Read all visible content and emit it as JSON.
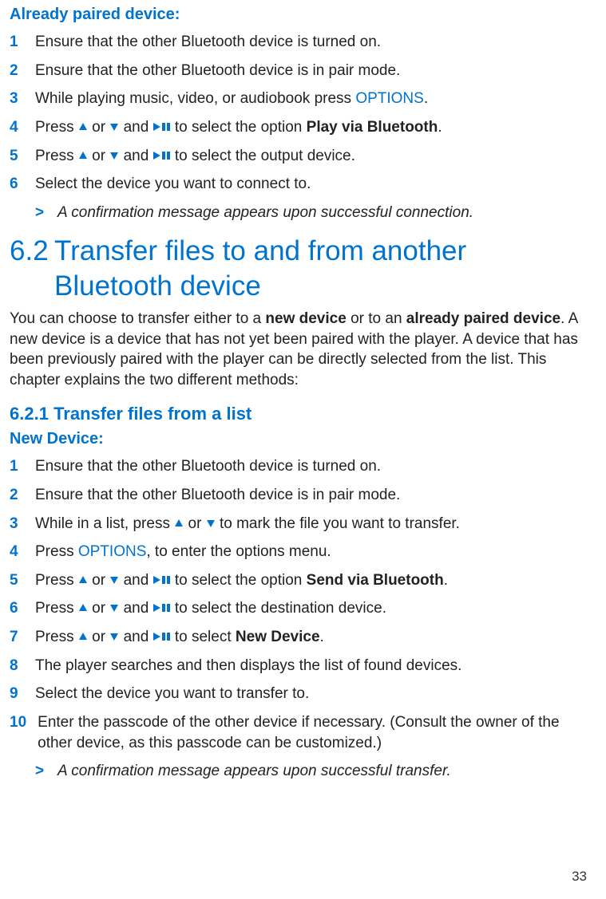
{
  "colors": {
    "accent": "#0073cf",
    "brand": "#009fe3"
  },
  "sectionA": {
    "heading": "Already paired device:",
    "steps": {
      "s1": "Ensure that the other Bluetooth device is turned on.",
      "s2": "Ensure that the other Bluetooth device is in pair mode.",
      "s3_a": "While playing music, video, or audiobook press ",
      "s3_opt": "OPTIONS",
      "s3_b": ".",
      "s4_a": "Press ",
      "s4_b": " or ",
      "s4_c": " and ",
      "s4_d": " to select the option ",
      "s4_e": "Play via Bluetooth",
      "s4_f": ".",
      "s5_a": "Press ",
      "s5_b": " or ",
      "s5_c": " and ",
      "s5_d": " to select the output device.",
      "s6": "Select the device you want to connect to."
    },
    "result": "A confirmation message appears upon successful connection."
  },
  "section62": {
    "number": "6.2",
    "title": "Transfer files to and from another Bluetooth device",
    "intro_a": "You can choose to transfer either to a ",
    "intro_b": "new device",
    "intro_c": " or to an ",
    "intro_d": "already paired device",
    "intro_e": ". A new device is a device that has not yet been paired with the player. A device that has been previously paired with the player can be directly selected from the list. This chapter explains the two different methods:"
  },
  "section621": {
    "number": "6.2.1",
    "title": "Transfer files from a list",
    "sub": "New Device:",
    "steps": {
      "s1": "Ensure that the other Bluetooth device is turned on.",
      "s2": "Ensure that the other Bluetooth device is in pair mode.",
      "s3_a": "While in a list, press ",
      "s3_b": " or ",
      "s3_c": " to mark the file you want to transfer.",
      "s4_a": "Press ",
      "s4_opt": "OPTIONS",
      "s4_b": ", to enter the options menu.",
      "s5_a": "Press ",
      "s5_b": " or ",
      "s5_c": " and ",
      "s5_d": " to select the option ",
      "s5_e": "Send via Bluetooth",
      "s5_f": ".",
      "s6_a": "Press ",
      "s6_b": " or ",
      "s6_c": " and ",
      "s6_d": " to select the destination device.",
      "s7_a": "Press ",
      "s7_b": " or ",
      "s7_c": " and ",
      "s7_d": " to select ",
      "s7_e": "New Device",
      "s7_f": ".",
      "s8": "The player searches and then displays the list of found devices.",
      "s9": "Select the device you want to transfer to.",
      "s10": "Enter the passcode of the other device if necessary. (Consult the owner of the other device, as this passcode can be customized.)"
    },
    "result": "A confirmation message appears upon successful transfer."
  },
  "icons": {
    "up": "up-arrow-icon",
    "down": "down-arrow-icon",
    "playpause": "play-pause-icon"
  },
  "page_number": "33"
}
